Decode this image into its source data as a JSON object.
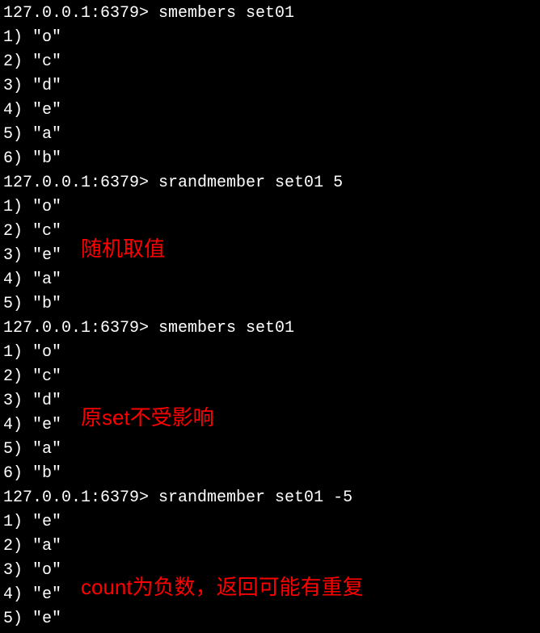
{
  "terminal": {
    "lines": [
      "127.0.0.1:6379> smembers set01",
      "1) \"o\"",
      "2) \"c\"",
      "3) \"d\"",
      "4) \"e\"",
      "5) \"a\"",
      "6) \"b\"",
      "127.0.0.1:6379> srandmember set01 5",
      "1) \"o\"",
      "2) \"c\"",
      "3) \"e\"",
      "4) \"a\"",
      "5) \"b\"",
      "127.0.0.1:6379> smembers set01",
      "1) \"o\"",
      "2) \"c\"",
      "3) \"d\"",
      "4) \"e\"",
      "5) \"a\"",
      "6) \"b\"",
      "127.0.0.1:6379> srandmember set01 -5",
      "1) \"e\"",
      "2) \"a\"",
      "3) \"o\"",
      "4) \"e\"",
      "5) \"e\""
    ]
  },
  "annotations": {
    "anno1": "随机取值",
    "anno2": "原set不受影响",
    "anno3": "count为负数，返回可能有重复"
  }
}
